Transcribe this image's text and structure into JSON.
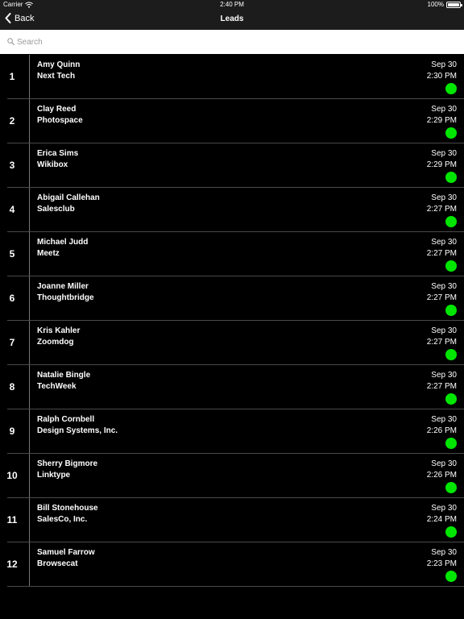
{
  "status": {
    "carrier": "Carrier",
    "time": "2:40 PM",
    "battery": "100%"
  },
  "nav": {
    "back_label": "Back",
    "title": "Leads"
  },
  "search": {
    "placeholder": "Search"
  },
  "leads": [
    {
      "index": "1",
      "name": "Amy Quinn",
      "company": "Next Tech",
      "date": "Sep 30",
      "time": "2:30 PM"
    },
    {
      "index": "2",
      "name": "Clay Reed",
      "company": "Photospace",
      "date": "Sep 30",
      "time": "2:29 PM"
    },
    {
      "index": "3",
      "name": "Erica Sims",
      "company": "Wikibox",
      "date": "Sep 30",
      "time": "2:29 PM"
    },
    {
      "index": "4",
      "name": "Abigail Callehan",
      "company": "Salesclub",
      "date": "Sep 30",
      "time": "2:27 PM"
    },
    {
      "index": "5",
      "name": "Michael Judd",
      "company": "Meetz",
      "date": "Sep 30",
      "time": "2:27 PM"
    },
    {
      "index": "6",
      "name": "Joanne Miller",
      "company": "Thoughtbridge",
      "date": "Sep 30",
      "time": "2:27 PM"
    },
    {
      "index": "7",
      "name": "Kris Kahler",
      "company": "Zoomdog",
      "date": "Sep 30",
      "time": "2:27 PM"
    },
    {
      "index": "8",
      "name": "Natalie Bingle",
      "company": "TechWeek",
      "date": "Sep 30",
      "time": "2:27 PM"
    },
    {
      "index": "9",
      "name": "Ralph Cornbell",
      "company": "Design Systems, Inc.",
      "date": "Sep 30",
      "time": "2:26 PM"
    },
    {
      "index": "10",
      "name": "Sherry Bigmore",
      "company": "Linktype",
      "date": "Sep 30",
      "time": "2:26 PM"
    },
    {
      "index": "11",
      "name": "Bill Stonehouse",
      "company": "SalesCo, Inc.",
      "date": "Sep 30",
      "time": "2:24 PM"
    },
    {
      "index": "12",
      "name": "Samuel Farrow",
      "company": "Browsecat",
      "date": "Sep 30",
      "time": "2:23 PM"
    }
  ],
  "colors": {
    "status_dot": "#00e600",
    "background": "#000000",
    "bar": "#1c1c1c"
  },
  "icons": {
    "wifi": "wifi-icon",
    "battery": "battery-icon",
    "back": "chevron-left-icon",
    "search": "search-icon",
    "status": "status-dot"
  }
}
